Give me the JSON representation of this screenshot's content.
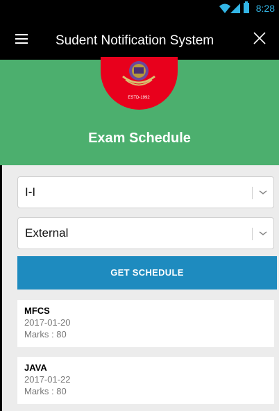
{
  "status_bar": {
    "time": "8:28",
    "icons": [
      "wifi-icon",
      "signal-icon",
      "battery-icon"
    ]
  },
  "app_bar": {
    "title": "Sudent Notification System",
    "menu_icon": "hamburger-icon",
    "close_icon": "close-icon"
  },
  "hero": {
    "title": "Exam Schedule",
    "logo_text": "ESTD-1992"
  },
  "form": {
    "semester": {
      "value": "I-I"
    },
    "exam_type": {
      "value": "External"
    },
    "submit_label": "GET SCHEDULE"
  },
  "schedule": [
    {
      "subject": "MFCS",
      "date": "2017-01-20",
      "marks": "Marks : 80"
    },
    {
      "subject": "JAVA",
      "date": "2017-01-22",
      "marks": "Marks : 80"
    }
  ],
  "colors": {
    "app_bar": "#000000",
    "hero": "#4caf6e",
    "logo": "#e8001c",
    "button": "#1e8bbf",
    "status_icons": "#33b5e5"
  }
}
